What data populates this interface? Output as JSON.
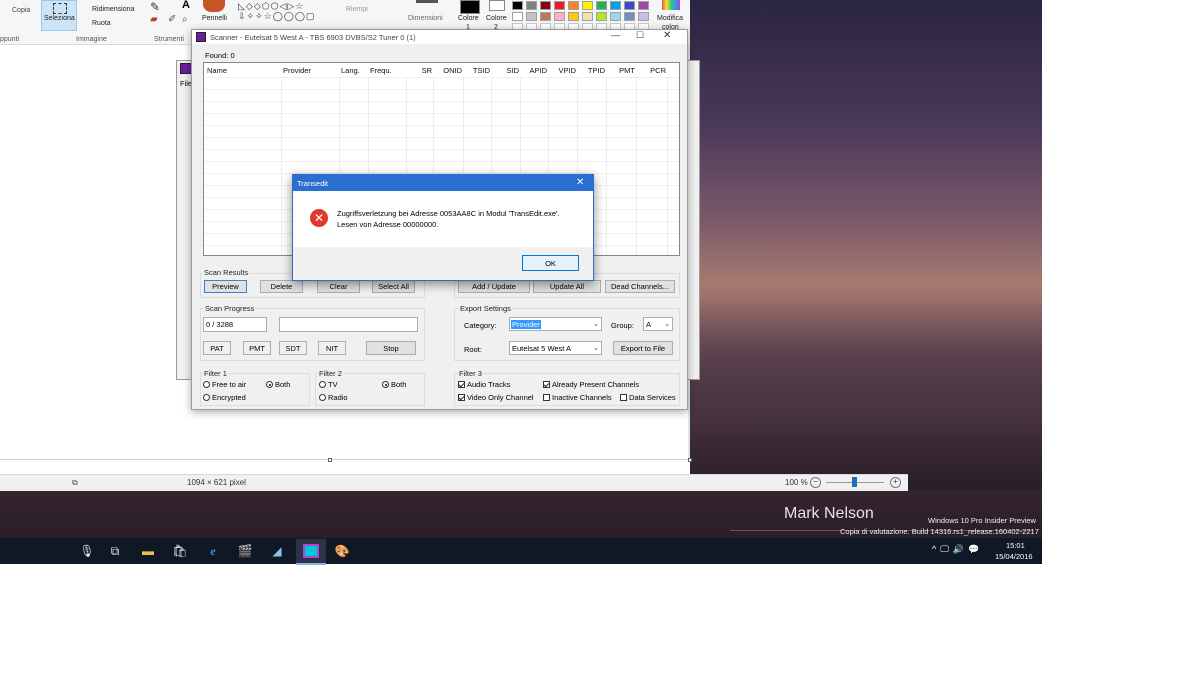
{
  "paint": {
    "ribbon": {
      "copy_label": "Copia",
      "select_label": "Seleziona",
      "resize_label": "Ridimensiona",
      "rotate_label": "Ruota",
      "brushes_label": "Pennelli",
      "fill_label": "Riempi",
      "size_label": "Dimensioni",
      "color1_label": "Colore",
      "color1_num": "1",
      "color2_label": "Colore",
      "color2_num": "2",
      "edit_colors_label": "Modifica",
      "edit_colors_label2": "colori",
      "group_clipboard": "ppunti",
      "group_image": "Immagine",
      "group_tools": "Strumenti",
      "palette": [
        "#000000",
        "#7f7f7f",
        "#880015",
        "#ed1c24",
        "#ff7f27",
        "#fff200",
        "#22b14c",
        "#00a2e8",
        "#3f48cc",
        "#a349a4",
        "#ffffff",
        "#c3c3c3",
        "#b97a57",
        "#ffaec9",
        "#ffc90e",
        "#efe4b0",
        "#b5e61d",
        "#99d9ea",
        "#7092be",
        "#c8bfe7"
      ]
    },
    "status": {
      "dimensions": "1094 × 621 pixel",
      "zoom": "100 %"
    }
  },
  "desktop": {
    "watermark_name": "Mark Nelson",
    "edition": "Windows 10 Pro Insider Preview",
    "build": "Copia di valutazione. Build 14316.rs1_release.160402-2217",
    "time": "15:01",
    "date": "15/04/2016"
  },
  "scanner": {
    "title": "Scanner - Eutelsat 5 West A - TBS 6903 DVBS/S2 Tuner 0 (1)",
    "found_label": "Found:",
    "found_count": "0",
    "columns": [
      "Name",
      "Provider",
      "Lang.",
      "Frequ.",
      "SR",
      "ONID",
      "TSID",
      "SID",
      "APID",
      "VPID",
      "TPID",
      "PMT",
      "PCR"
    ],
    "scan_results": {
      "label": "Scan Results",
      "preview": "Preview",
      "delete": "Delete",
      "clear": "Clear",
      "select_all": "Select All"
    },
    "actions": {
      "add_update": "Add / Update",
      "update_all": "Update All",
      "dead_channels": "Dead Channels..."
    },
    "scan_progress": {
      "label": "Scan Progress",
      "counter": "0 / 3288",
      "pat": "PAT",
      "pmt": "PMT",
      "sdt": "SDT",
      "nit": "NIT",
      "stop": "Stop"
    },
    "export": {
      "label": "Export Settings",
      "category_label": "Category:",
      "category_value": "Provider",
      "group_label": "Group:",
      "group_value": "A",
      "root_label": "Root:",
      "root_value": "Eutelsat 5 West A",
      "export_button": "Export to File"
    },
    "filter1": {
      "label": "Filter 1",
      "free": "Free to air",
      "both": "Both",
      "encrypted": "Encrypted"
    },
    "filter2": {
      "label": "Filter 2",
      "tv": "TV",
      "both": "Both",
      "radio": "Radio"
    },
    "filter3": {
      "label": "Filter 3",
      "audio": "Audio Tracks",
      "already": "Already Present Channels",
      "video_only": "Video Only Channel",
      "inactive": "Inactive Channels",
      "data": "Data Services"
    }
  },
  "dialog": {
    "title": "Transedit",
    "message_line1": "Zugriffsverletzung bei Adresse 0053AA8C in Modul 'TransEdit.exe'.",
    "message_line2": "Lesen von Adresse 00000000.",
    "ok": "OK"
  },
  "background_window": {
    "menu_file": "File"
  }
}
